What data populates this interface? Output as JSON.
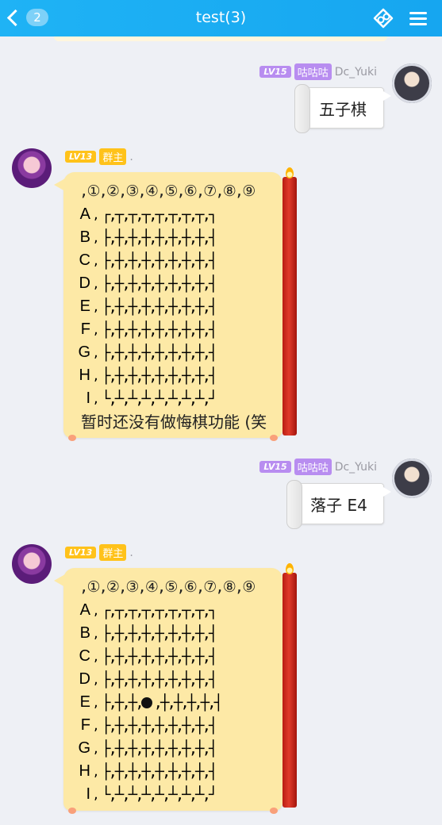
{
  "header": {
    "back_badge": "2",
    "title": "test(3)"
  },
  "messages": [
    {
      "side": "right",
      "level": "LV15",
      "role": "咕咕咕",
      "name": "Dc_Yuki",
      "text": "五子棋"
    },
    {
      "side": "left",
      "level": "LV13",
      "role": "群主",
      "name": ".",
      "col_header": ",①,②,③,④,⑤,⑥,⑦,⑧,⑨",
      "rows": [
        {
          "label": "A",
          "cells": "┌,┬,┬,┬,┬,┬,┬,┬,┐"
        },
        {
          "label": "B",
          "cells": "├,┼,┼,┼,┼,┼,┼,┼,┤"
        },
        {
          "label": "C",
          "cells": "├,┼,┼,┼,┼,┼,┼,┼,┤"
        },
        {
          "label": "D",
          "cells": "├,┼,┼,┼,┼,┼,┼,┼,┤"
        },
        {
          "label": "E",
          "cells": "├,┼,┼,┼,┼,┼,┼,┼,┤"
        },
        {
          "label": "F",
          "cells": "├,┼,┼,┼,┼,┼,┼,┼,┤"
        },
        {
          "label": "G",
          "cells": "├,┼,┼,┼,┼,┼,┼,┼,┤"
        },
        {
          "label": "H",
          "cells": "├,┼,┼,┼,┼,┼,┼,┼,┤"
        },
        {
          "label": "I",
          "cells": "└,┴,┴,┴,┴,┴,┴,┴,┘"
        }
      ],
      "footer": "暂时还没有做悔棋功能 (笑"
    },
    {
      "side": "right",
      "level": "LV15",
      "role": "咕咕咕",
      "name": "Dc_Yuki",
      "text": "落子 E4"
    },
    {
      "side": "left",
      "level": "LV13",
      "role": "群主",
      "name": ".",
      "col_header": ",①,②,③,④,⑤,⑥,⑦,⑧,⑨",
      "rows": [
        {
          "label": "A",
          "cells": "┌,┬,┬,┬,┬,┬,┬,┬,┐"
        },
        {
          "label": "B",
          "cells": "├,┼,┼,┼,┼,┼,┼,┼,┤"
        },
        {
          "label": "C",
          "cells": "├,┼,┼,┼,┼,┼,┼,┼,┤"
        },
        {
          "label": "D",
          "cells": "├,┼,┼,┼,┼,┼,┼,┼,┤"
        },
        {
          "label": "E",
          "cells_before": "├,┼,┼,",
          "stone": "●",
          "cells_after": ",┼,┼,┼,┼,┤"
        },
        {
          "label": "F",
          "cells": "├,┼,┼,┼,┼,┼,┼,┼,┤"
        },
        {
          "label": "G",
          "cells": "├,┼,┼,┼,┼,┼,┼,┼,┤"
        },
        {
          "label": "H",
          "cells": "├,┼,┼,┼,┼,┼,┼,┼,┤"
        },
        {
          "label": "I",
          "cells": "└,┴,┴,┴,┴,┴,┴,┴,┘"
        }
      ]
    }
  ],
  "colors": {
    "header": "#16a6f0",
    "background": "#eef0f5",
    "board_bubble": "#fde9a6",
    "level_purple": "#b88df0",
    "level_orange": "#ffc21a"
  }
}
